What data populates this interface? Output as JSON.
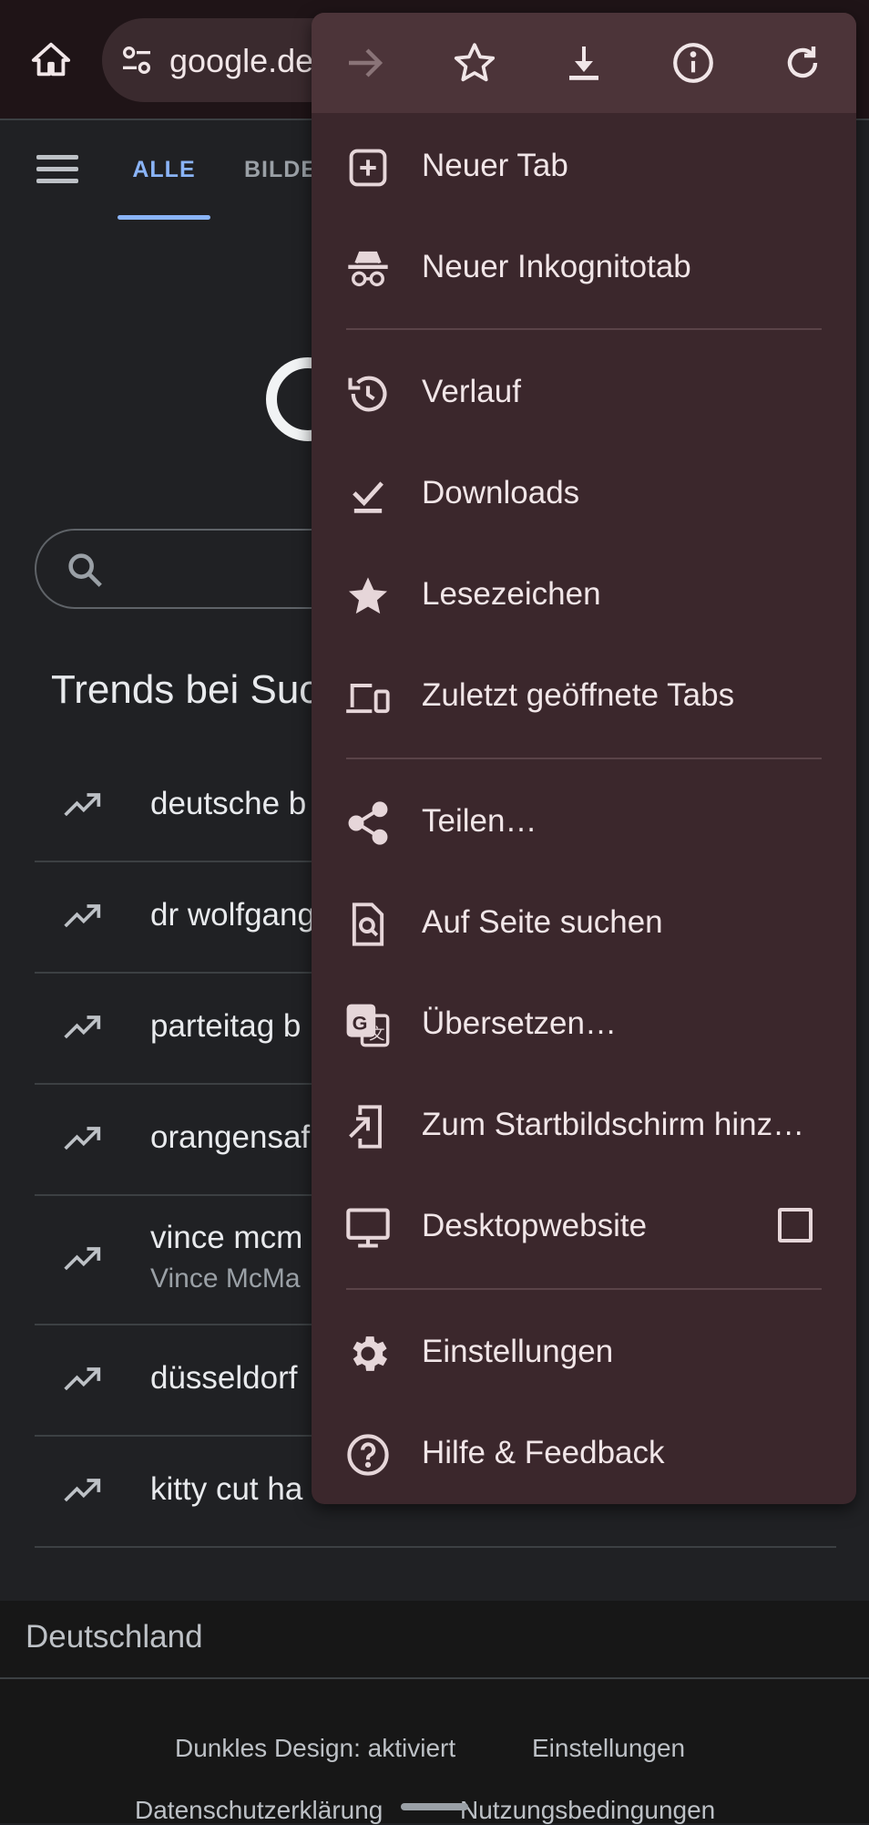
{
  "browser": {
    "url": "google.de"
  },
  "google": {
    "tab_all": "ALLE",
    "tab_images": "BILDE",
    "trends_title": "Trends bei Suc",
    "trends": [
      {
        "text": "deutsche b",
        "sub": ""
      },
      {
        "text": "dr wolfgang",
        "sub": ""
      },
      {
        "text": "parteitag b",
        "sub": ""
      },
      {
        "text": "orangensaf",
        "sub": ""
      },
      {
        "text": "vince mcm",
        "sub": "Vince McMa"
      },
      {
        "text": "düsseldorf",
        "sub": ""
      },
      {
        "text": "kitty cut ha",
        "sub": ""
      }
    ],
    "region": "Deutschland",
    "footer": {
      "dark_mode": "Dunkles Design: aktiviert",
      "settings": "Einstellungen",
      "privacy": "Datenschutzerklärung",
      "terms": "Nutzungsbedingungen"
    }
  },
  "menu": {
    "toolbar": [
      "forward-icon",
      "bookmark-star-icon",
      "download-icon",
      "info-icon",
      "reload-icon"
    ],
    "items": [
      {
        "label": "Neuer Tab",
        "icon": "new-tab-icon"
      },
      {
        "label": "Neuer Inkognitotab",
        "icon": "incognito-icon"
      },
      {
        "label": "Verlauf",
        "icon": "history-icon"
      },
      {
        "label": "Downloads",
        "icon": "downloads-icon"
      },
      {
        "label": "Lesezeichen",
        "icon": "bookmarks-icon"
      },
      {
        "label": "Zuletzt geöffnete Tabs",
        "icon": "recent-tabs-icon"
      },
      {
        "label": "Teilen…",
        "icon": "share-icon"
      },
      {
        "label": "Auf Seite suchen",
        "icon": "find-in-page-icon"
      },
      {
        "label": "Übersetzen…",
        "icon": "translate-icon"
      },
      {
        "label": "Zum Startbildschirm hinz…",
        "icon": "add-to-home-icon"
      },
      {
        "label": "Desktopwebsite",
        "icon": "desktop-icon",
        "checked": false
      },
      {
        "label": "Einstellungen",
        "icon": "settings-icon"
      },
      {
        "label": "Hilfe & Feedback",
        "icon": "help-icon"
      }
    ]
  },
  "colors": {
    "accent": "#8ab4f8",
    "menu_bg": "#3b272c",
    "page_bg": "#202124"
  }
}
